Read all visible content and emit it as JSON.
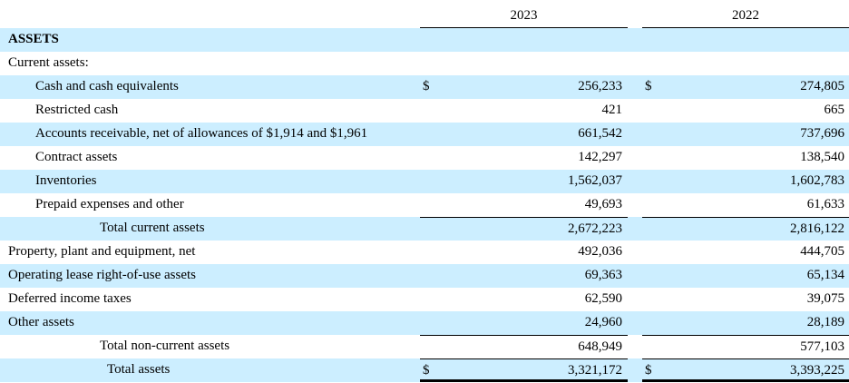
{
  "columns": [
    "2023",
    "2022"
  ],
  "rows": [
    {
      "label": "ASSETS",
      "style": "bold",
      "indent": 0,
      "values": [
        "",
        ""
      ]
    },
    {
      "label": "Current assets:",
      "indent": 0,
      "values": [
        "",
        ""
      ]
    },
    {
      "label": "Cash and cash equivalents",
      "indent": 1,
      "currency": "$",
      "values": [
        "256,233",
        "274,805"
      ]
    },
    {
      "label": "Restricted cash",
      "indent": 1,
      "values": [
        "421",
        "665"
      ]
    },
    {
      "label": "Accounts receivable, net of allowances of $1,914 and $1,961",
      "indent": 1,
      "values": [
        "661,542",
        "737,696"
      ]
    },
    {
      "label": "Contract assets",
      "indent": 1,
      "values": [
        "142,297",
        "138,540"
      ]
    },
    {
      "label": "Inventories",
      "indent": 1,
      "values": [
        "1,562,037",
        "1,602,783"
      ]
    },
    {
      "label": "Prepaid expenses and other",
      "indent": 1,
      "values": [
        "49,693",
        "61,633"
      ]
    },
    {
      "label": "Total current assets",
      "indent": 2,
      "topline": true,
      "values": [
        "2,672,223",
        "2,816,122"
      ]
    },
    {
      "label": "Property, plant and equipment, net",
      "indent": 0,
      "values": [
        "492,036",
        "444,705"
      ]
    },
    {
      "label": "Operating lease right-of-use assets",
      "indent": 0,
      "values": [
        "69,363",
        "65,134"
      ]
    },
    {
      "label": "Deferred income taxes",
      "indent": 0,
      "values": [
        "62,590",
        "39,075"
      ]
    },
    {
      "label": "Other assets",
      "indent": 0,
      "values": [
        "24,960",
        "28,189"
      ]
    },
    {
      "label": "Total non-current assets",
      "indent": 2,
      "topline": true,
      "values": [
        "648,949",
        "577,103"
      ]
    },
    {
      "label": "Total assets",
      "indent": 3,
      "topline": true,
      "double": true,
      "currency": "$",
      "values": [
        "3,321,172",
        "3,393,225"
      ]
    }
  ],
  "colors": {
    "stripe": "#cceeff"
  }
}
